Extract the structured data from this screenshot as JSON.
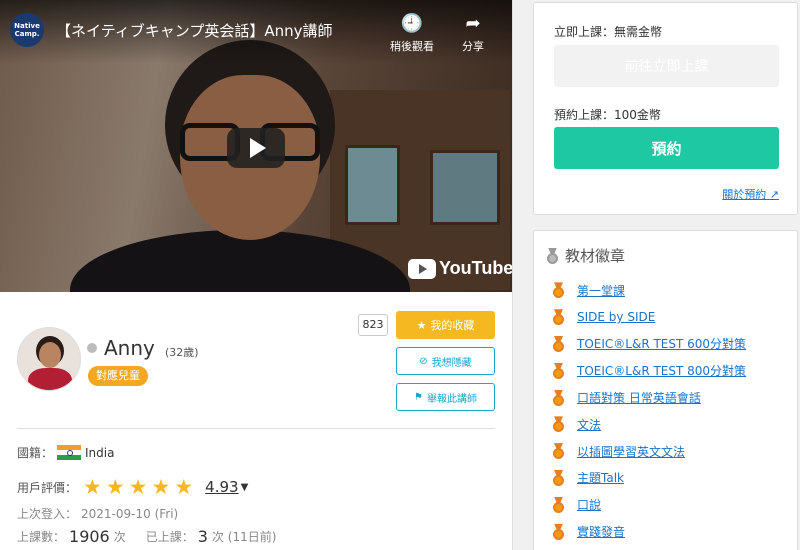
{
  "video": {
    "channel_logo": "Native Camp.",
    "title": "【ネイティブキャンプ英会話】Anny講師",
    "watch_later": "稍後觀看",
    "share": "分享",
    "brand": "YouTube"
  },
  "teacher": {
    "name": "Anny",
    "age": "(32歲)",
    "kids_badge": "對應兒童",
    "favorite_count": "823",
    "favorite_label": "我的收藏",
    "hide_label": "我想隱藏",
    "report_label": "舉報此講師",
    "nationality_label": "國籍：",
    "nationality": "India",
    "rating_label": "用戶評價：",
    "rating": "4.93",
    "stars": "★★★★★",
    "last_login_label": "上次登入：",
    "last_login": "2021-09-10 (Fri)",
    "lessons_label": "上課數：",
    "lessons": "1906",
    "lessons_unit": "次",
    "taken_label": "已上課：",
    "taken": "3",
    "taken_unit": "次 (11日前)"
  },
  "booking": {
    "instant_label": "立即上課：無需金幣",
    "instant_button": "前往立即上課",
    "reserve_label": "預約上課：100金幣",
    "reserve_button": "預約",
    "about_link": "關於預約"
  },
  "badges": {
    "title": "教材徽章",
    "items": [
      "第一堂課",
      "SIDE by SIDE",
      "TOEIC®L&R TEST 600分對策",
      "TOEIC®L&R TEST 800分對策",
      "口語對策 日常英語會話",
      "文法",
      "以插圖學習英文文法",
      "主題Talk",
      "口說",
      "實踐發音"
    ]
  },
  "colors": {
    "favorite": "#f5b820",
    "reserve": "#1ec8a3",
    "link": "#1a73c8",
    "outline_button": "#1aa7c8",
    "kids_badge": "#f5a623"
  }
}
